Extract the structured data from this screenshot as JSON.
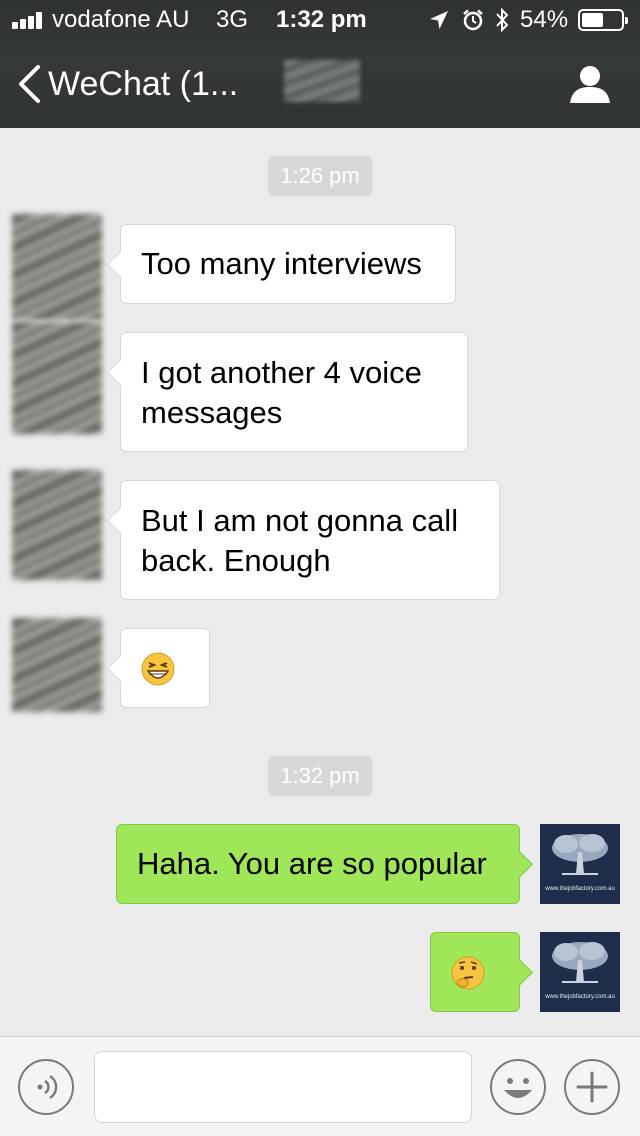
{
  "status_bar": {
    "carrier": "vodafone AU",
    "network": "3G",
    "time": "1:32 pm",
    "battery_percent": "54%",
    "battery_level": 0.54,
    "icons": [
      "signal-bars-icon",
      "location-arrow-icon",
      "alarm-clock-icon",
      "bluetooth-icon",
      "battery-icon"
    ]
  },
  "nav": {
    "back_label": "WeChat (1...",
    "contact_name_redacted": true,
    "icons": [
      "back-chevron-icon",
      "profile-icon"
    ]
  },
  "messages": [
    {
      "type": "timestamp",
      "text": "1:26 pm"
    },
    {
      "type": "incoming",
      "text": "Too many interviews"
    },
    {
      "type": "incoming",
      "text": "I got another 4 voice messages"
    },
    {
      "type": "incoming",
      "text": "But I am not gonna call back. Enough"
    },
    {
      "type": "incoming",
      "emoji": "grinning-squint-emoji"
    },
    {
      "type": "timestamp",
      "text": "1:32 pm"
    },
    {
      "type": "outgoing",
      "text": "Haha. You are so popular"
    },
    {
      "type": "outgoing",
      "emoji": "thinking-emoji"
    }
  ],
  "my_avatar": {
    "watermark": "www.thejobfactory.com.au",
    "bg_color": "#1f2d4b"
  },
  "input_bar": {
    "placeholder": "",
    "icons": [
      "voice-input-icon",
      "emoji-picker-icon",
      "add-more-icon"
    ]
  },
  "colors": {
    "header_bg": "#2f3331",
    "chat_bg": "#ebebeb",
    "outgoing_bubble": "#9fe658",
    "incoming_bubble": "#ffffff",
    "timestamp_bg": "#d7d7d7"
  }
}
